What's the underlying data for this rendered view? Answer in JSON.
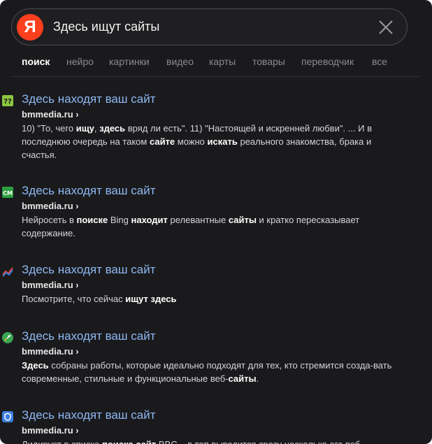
{
  "search": {
    "logo_letter": "Я",
    "query": "Здесь ищут сайты"
  },
  "tabs": [
    "поиск",
    "нейро",
    "картинки",
    "видео",
    "карты",
    "товары",
    "переводчик",
    "все"
  ],
  "results": [
    {
      "title": "Здесь находят ваш сайт",
      "domain": "bmmedia.ru ›",
      "favicon": "question-badge-icon",
      "snippet": [
        {
          "t": "10) \"То, чего "
        },
        {
          "t": "ищу",
          "b": true
        },
        {
          "t": ", "
        },
        {
          "t": "здесь",
          "b": true
        },
        {
          "t": " вряд ли есть\". 11) \"Настоящей и искренней любви\". ... И в последнюю очередь на таком "
        },
        {
          "t": "сайте",
          "b": true
        },
        {
          "t": " можно "
        },
        {
          "t": "искать",
          "b": true
        },
        {
          "t": " реального знакомства, брака и счастья."
        }
      ]
    },
    {
      "title": "Здесь находят ваш сайт",
      "domain": "bmmedia.ru ›",
      "favicon": "cm-badge-icon",
      "snippet": [
        {
          "t": "Нейросеть в "
        },
        {
          "t": "поиске",
          "b": true
        },
        {
          "t": " Bing "
        },
        {
          "t": "находит",
          "b": true
        },
        {
          "t": " релевантные "
        },
        {
          "t": "сайты",
          "b": true
        },
        {
          "t": " и кратко пересказывает содержание."
        }
      ]
    },
    {
      "title": "Здесь находят ваш сайт",
      "domain": "bmmedia.ru ›",
      "favicon": "trend-chart-icon",
      "snippet": [
        {
          "t": "Посмотрите, что сейчас "
        },
        {
          "t": "ищут здесь",
          "b": true
        }
      ]
    },
    {
      "title": "Здесь находят ваш сайт",
      "domain": "bmmedia.ru ›",
      "favicon": "rocket-icon",
      "snippet": [
        {
          "t": "Здесь",
          "b": true
        },
        {
          "t": " собраны работы, которые идеально подходят для тех, кто стремится созда-вать современные, стильные и функциональные веб-"
        },
        {
          "t": "сайты",
          "b": true
        },
        {
          "t": "."
        }
      ]
    },
    {
      "title": "Здесь находят ваш сайт",
      "domain": "bmmedia.ru ›",
      "favicon": "shield-badge-icon",
      "snippet": [
        {
          "t": "Лидирует в списке "
        },
        {
          "t": "поиска сайт",
          "b": true
        },
        {
          "t": " BBC – в топ выводится сразу несколько его веб-"
        }
      ]
    }
  ],
  "colors": {
    "background": "#1a1a1d",
    "link": "#8fb8f2",
    "brand": "#fc3f1d"
  }
}
